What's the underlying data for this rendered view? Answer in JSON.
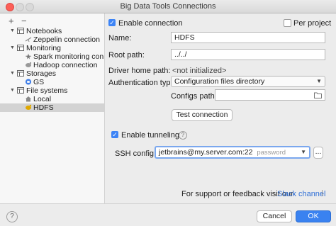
{
  "window": {
    "title": "Big Data Tools Connections"
  },
  "toolbar": {
    "add": "+",
    "remove": "−"
  },
  "tree": [
    {
      "label": "Notebooks",
      "icon": "notebook-folder-icon",
      "expanded": true
    },
    {
      "label": "Zeppelin connection",
      "icon": "zeppelin-icon"
    },
    {
      "label": "Monitoring",
      "icon": "monitoring-folder-icon",
      "expanded": true
    },
    {
      "label": "Spark monitoring connec",
      "icon": "spark-icon"
    },
    {
      "label": "Hadoop connection",
      "icon": "hadoop-icon"
    },
    {
      "label": "Storages",
      "icon": "storages-folder-icon",
      "expanded": true
    },
    {
      "label": "GS",
      "icon": "google-storage-icon"
    },
    {
      "label": "File systems",
      "icon": "filesystems-folder-icon",
      "expanded": true
    },
    {
      "label": "Local",
      "icon": "local-home-icon"
    },
    {
      "label": "HDFS",
      "icon": "hdfs-icon",
      "selected": true
    }
  ],
  "form": {
    "enable_connection": "Enable connection",
    "per_project": "Per project",
    "name_label": "Name:",
    "name_value": "HDFS",
    "root_path_label": "Root path:",
    "root_path_value": "../../",
    "driver_home_label": "Driver home path:",
    "driver_home_value": "<not initialized>",
    "auth_type_label": "Authentication type:",
    "auth_type_value": "Configuration files directory",
    "configs_path_label": "Configs path:",
    "configs_path_value": "",
    "test_connection": "Test connection",
    "enable_tunneling": "Enable tunneling",
    "ssh_config_label": "SSH config:",
    "ssh_config_value": "jetbrains@my.server.com:22",
    "ssh_config_hint": "password",
    "ssh_more": "...",
    "support_text": "For support or feedback visit our",
    "slack_link": "Slack channel"
  },
  "footer": {
    "help": "?",
    "cancel": "Cancel",
    "ok": "OK"
  },
  "colors": {
    "accent": "#3a82f0",
    "link": "#2f6fd6",
    "selection": "#d3d3d3"
  }
}
